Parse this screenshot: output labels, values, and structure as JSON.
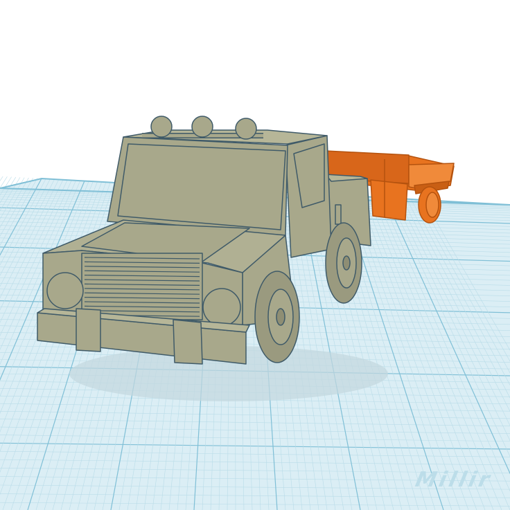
{
  "workplane": {
    "units_label": "Millir",
    "grid_fill": "#dbeef5",
    "grid_line_minor": "#b9dce8",
    "grid_line_major": "#7fbfd6"
  },
  "objects": [
    {
      "name": "pickup-truck",
      "color": "#a8a88b"
    },
    {
      "name": "flatbed-trailer",
      "color": "#e8731f"
    }
  ],
  "colors": {
    "truck_body": "#a8a88b",
    "truck_dark": "#8e8e74",
    "truck_outline": "#3f5a68",
    "trailer_body": "#e8731f",
    "trailer_dark": "#c95f14",
    "shadow": "#c9dde4"
  }
}
